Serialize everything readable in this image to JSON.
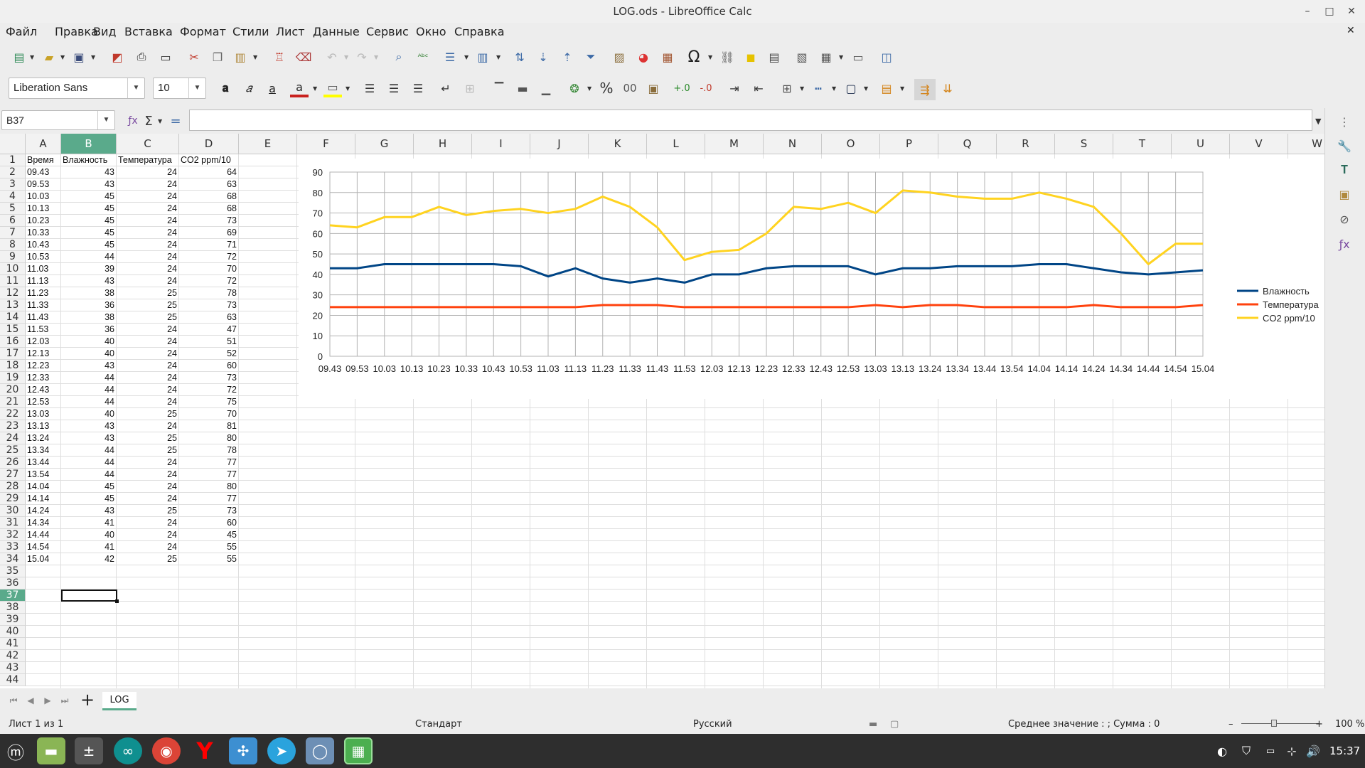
{
  "window": {
    "title": "LOG.ods - LibreOffice Calc"
  },
  "menu": [
    "Файл",
    "Правка",
    "Вид",
    "Вставка",
    "Формат",
    "Стили",
    "Лист",
    "Данные",
    "Сервис",
    "Окно",
    "Справка"
  ],
  "toolbar": {
    "font_name": "Liberation Sans",
    "font_size": "10"
  },
  "formula": {
    "name_box": "B37",
    "content": ""
  },
  "columns": [
    "A",
    "B",
    "C",
    "D",
    "E",
    "F",
    "G",
    "H",
    "I",
    "J",
    "K",
    "L",
    "M",
    "N",
    "O",
    "P",
    "Q",
    "R",
    "S",
    "T",
    "U",
    "V",
    "W"
  ],
  "rows": [
    "1",
    "2",
    "3",
    "4",
    "5",
    "6",
    "7",
    "8",
    "9",
    "10",
    "11",
    "12",
    "13",
    "14",
    "15",
    "16",
    "17",
    "18",
    "19",
    "20",
    "21",
    "22",
    "23",
    "24",
    "25",
    "26",
    "27",
    "28",
    "29",
    "30",
    "31",
    "32",
    "33",
    "34",
    "35",
    "36",
    "37",
    "38",
    "39",
    "40",
    "41",
    "42",
    "43",
    "44"
  ],
  "sheet": {
    "headers": [
      "Время",
      "Влажность",
      "Температура",
      "CO2 ppm/10"
    ],
    "data": [
      [
        "09.43",
        "43",
        "24",
        "64"
      ],
      [
        "09.53",
        "43",
        "24",
        "63"
      ],
      [
        "10.03",
        "45",
        "24",
        "68"
      ],
      [
        "10.13",
        "45",
        "24",
        "68"
      ],
      [
        "10.23",
        "45",
        "24",
        "73"
      ],
      [
        "10.33",
        "45",
        "24",
        "69"
      ],
      [
        "10.43",
        "45",
        "24",
        "71"
      ],
      [
        "10.53",
        "44",
        "24",
        "72"
      ],
      [
        "11.03",
        "39",
        "24",
        "70"
      ],
      [
        "11.13",
        "43",
        "24",
        "72"
      ],
      [
        "11.23",
        "38",
        "25",
        "78"
      ],
      [
        "11.33",
        "36",
        "25",
        "73"
      ],
      [
        "11.43",
        "38",
        "25",
        "63"
      ],
      [
        "11.53",
        "36",
        "24",
        "47"
      ],
      [
        "12.03",
        "40",
        "24",
        "51"
      ],
      [
        "12.13",
        "40",
        "24",
        "52"
      ],
      [
        "12.23",
        "43",
        "24",
        "60"
      ],
      [
        "12.33",
        "44",
        "24",
        "73"
      ],
      [
        "12.43",
        "44",
        "24",
        "72"
      ],
      [
        "12.53",
        "44",
        "24",
        "75"
      ],
      [
        "13.03",
        "40",
        "25",
        "70"
      ],
      [
        "13.13",
        "43",
        "24",
        "81"
      ],
      [
        "13.24",
        "43",
        "25",
        "80"
      ],
      [
        "13.34",
        "44",
        "25",
        "78"
      ],
      [
        "13.44",
        "44",
        "24",
        "77"
      ],
      [
        "13.54",
        "44",
        "24",
        "77"
      ],
      [
        "14.04",
        "45",
        "24",
        "80"
      ],
      [
        "14.14",
        "45",
        "24",
        "77"
      ],
      [
        "14.24",
        "43",
        "25",
        "73"
      ],
      [
        "14.34",
        "41",
        "24",
        "60"
      ],
      [
        "14.44",
        "40",
        "24",
        "45"
      ],
      [
        "14.54",
        "41",
        "24",
        "55"
      ],
      [
        "15.04",
        "42",
        "25",
        "55"
      ]
    ]
  },
  "chart_data": {
    "type": "line",
    "categories": [
      "09.43",
      "09.53",
      "10.03",
      "10.13",
      "10.23",
      "10.33",
      "10.43",
      "10.53",
      "11.03",
      "11.13",
      "11.23",
      "11.33",
      "11.43",
      "11.53",
      "12.03",
      "12.13",
      "12.23",
      "12.33",
      "12.43",
      "12.53",
      "13.03",
      "13.13",
      "13.24",
      "13.34",
      "13.44",
      "13.54",
      "14.04",
      "14.14",
      "14.24",
      "14.34",
      "14.44",
      "14.54",
      "15.04"
    ],
    "series": [
      {
        "name": "Влажность",
        "color": "#004586",
        "values": [
          43,
          43,
          45,
          45,
          45,
          45,
          45,
          44,
          39,
          43,
          38,
          36,
          38,
          36,
          40,
          40,
          43,
          44,
          44,
          44,
          40,
          43,
          43,
          44,
          44,
          44,
          45,
          45,
          43,
          41,
          40,
          41,
          42
        ]
      },
      {
        "name": "Температура",
        "color": "#ff420e",
        "values": [
          24,
          24,
          24,
          24,
          24,
          24,
          24,
          24,
          24,
          24,
          25,
          25,
          25,
          24,
          24,
          24,
          24,
          24,
          24,
          24,
          25,
          24,
          25,
          25,
          24,
          24,
          24,
          24,
          25,
          24,
          24,
          24,
          25
        ]
      },
      {
        "name": "CO2 ppm/10",
        "color": "#ffd320",
        "values": [
          64,
          63,
          68,
          68,
          73,
          69,
          71,
          72,
          70,
          72,
          78,
          73,
          63,
          47,
          51,
          52,
          60,
          73,
          72,
          75,
          70,
          81,
          80,
          78,
          77,
          77,
          80,
          77,
          73,
          60,
          45,
          55,
          55
        ]
      }
    ],
    "ylim": [
      0,
      90
    ],
    "yticks": [
      "0",
      "10",
      "20",
      "30",
      "40",
      "50",
      "60",
      "70",
      "80",
      "90"
    ],
    "grid": true,
    "legend": "right"
  },
  "tabs": {
    "active": "LOG",
    "add": "+"
  },
  "status": {
    "sheet": "Лист 1 из 1",
    "style": "Стандарт",
    "lang": "Русский",
    "summary": "Среднее значение : ; Сумма : 0",
    "zoom": "100 %"
  },
  "taskbar": {
    "clock": "15:37"
  }
}
